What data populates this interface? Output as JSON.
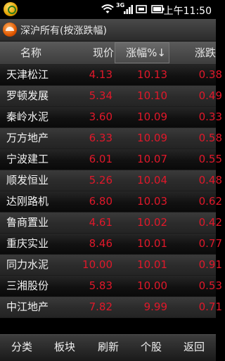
{
  "status_bar": {
    "time": "上午11:50",
    "network": "3G"
  },
  "title_bar": {
    "title": "深沪所有(按涨跌幅)"
  },
  "table": {
    "headers": {
      "name": "名称",
      "price": "现价",
      "pct_change": "涨幅%↓",
      "change": "涨跌"
    },
    "rows": [
      {
        "name": "天津松江",
        "price": "4.13",
        "pct": "10.13",
        "chg": "0.38"
      },
      {
        "name": "罗顿发展",
        "price": "5.34",
        "pct": "10.10",
        "chg": "0.49"
      },
      {
        "name": "秦岭水泥",
        "price": "3.60",
        "pct": "10.09",
        "chg": "0.33"
      },
      {
        "name": "万方地产",
        "price": "6.33",
        "pct": "10.09",
        "chg": "0.58"
      },
      {
        "name": "宁波建工",
        "price": "6.01",
        "pct": "10.07",
        "chg": "0.55"
      },
      {
        "name": "顺发恒业",
        "price": "5.26",
        "pct": "10.04",
        "chg": "0.48"
      },
      {
        "name": "达刚路机",
        "price": "6.80",
        "pct": "10.03",
        "chg": "0.62"
      },
      {
        "name": "鲁商置业",
        "price": "4.61",
        "pct": "10.02",
        "chg": "0.42"
      },
      {
        "name": "重庆实业",
        "price": "8.46",
        "pct": "10.01",
        "chg": "0.77"
      },
      {
        "name": "同力水泥",
        "price": "10.00",
        "pct": "10.01",
        "chg": "0.91"
      },
      {
        "name": "三湘股份",
        "price": "5.83",
        "pct": "10.00",
        "chg": "0.53"
      },
      {
        "name": "中江地产",
        "price": "7.82",
        "pct": "9.99",
        "chg": "0.71"
      }
    ]
  },
  "bottom_bar": {
    "tabs": [
      "分类",
      "板块",
      "刷新",
      "个股",
      "返回"
    ]
  },
  "colors": {
    "up_red": "#e0182a"
  }
}
